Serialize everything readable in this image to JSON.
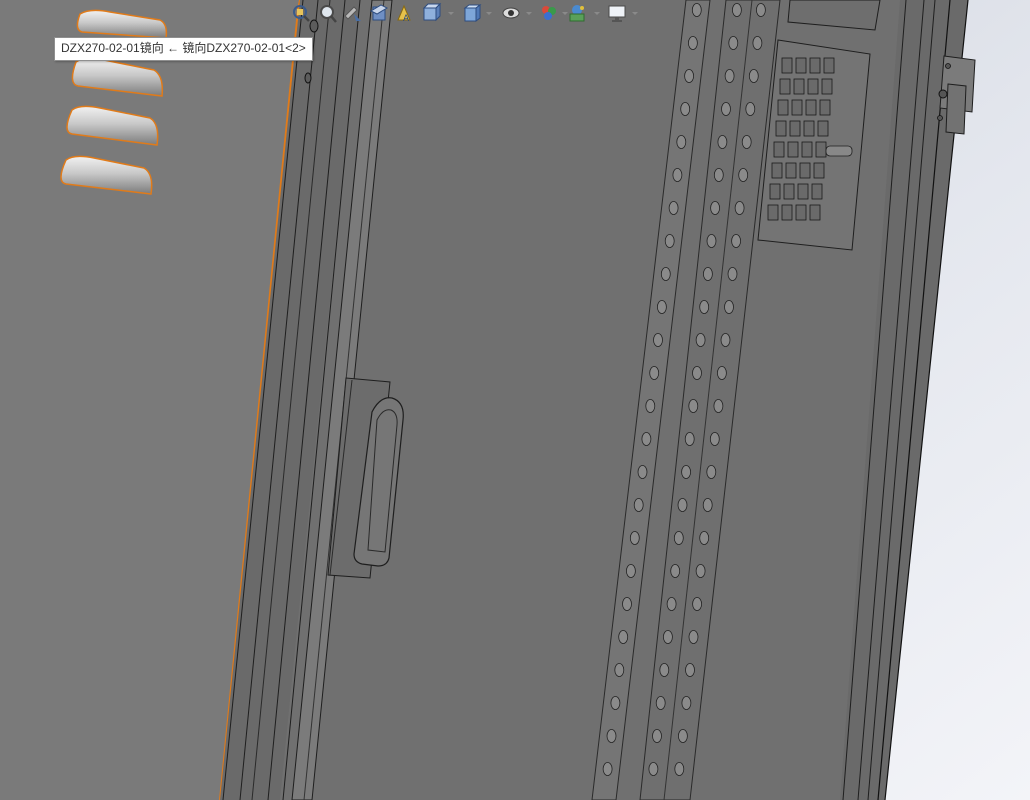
{
  "tooltip": {
    "text": "DZX270-02-01镜向 ← 镜向DZX270-02-01<2>"
  },
  "hud_toolbar": {
    "buttons": [
      {
        "icon": "zoom-to-fit-icon"
      },
      {
        "icon": "zoom-to-area-icon"
      },
      {
        "icon": "previous-view-icon"
      },
      {
        "icon": "section-view-icon"
      },
      {
        "icon": "dynamic-annotation-views-icon"
      },
      {
        "icon": "view-orientation-icon"
      },
      {
        "icon": "display-style-icon"
      },
      {
        "icon": "hide-show-items-icon"
      },
      {
        "icon": "edit-appearance-icon"
      },
      {
        "icon": "apply-scene-icon"
      },
      {
        "icon": "view-settings-icon"
      }
    ]
  },
  "colors": {
    "model_gray": "#6e6e6e",
    "selection_highlight": "#e07b1a",
    "background_right": "#e9ecf3",
    "edge_line": "#1e1e1e"
  }
}
